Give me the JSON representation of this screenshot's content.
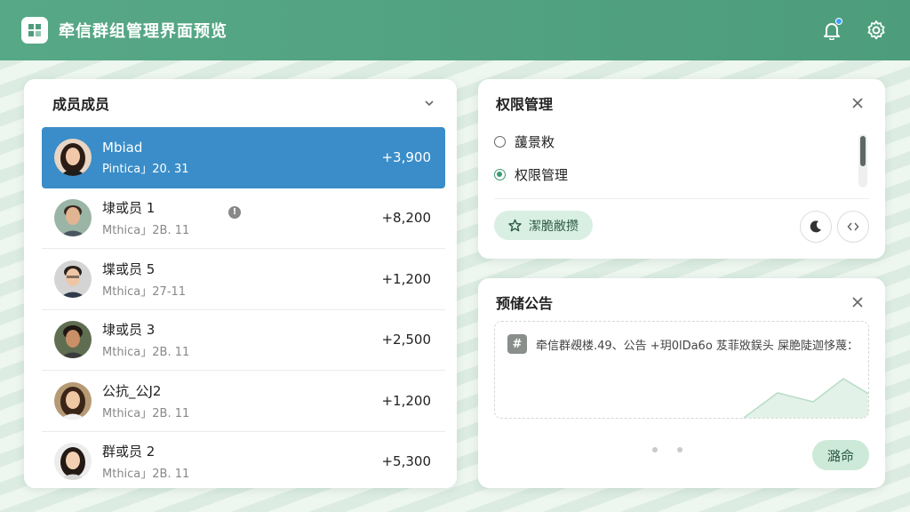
{
  "header": {
    "title": "牵信群组管理界面预览",
    "logo_icon": "grid-logo-icon",
    "actions": [
      {
        "icon": "bell-icon",
        "has_badge": true
      },
      {
        "icon": "gear-icon"
      }
    ]
  },
  "members": {
    "title": "成员成员",
    "items": [
      {
        "name": "Mbiad",
        "sub": "Pintica」20. 31",
        "value": "+3,900",
        "selected": true
      },
      {
        "name": "埭或员 1",
        "sub": "Mthica」2B. 11",
        "value": "+8,200",
        "info": "!"
      },
      {
        "name": "堞或员 5",
        "sub": "Mthica」27-11",
        "value": "+1,200"
      },
      {
        "name": "埭或员 3",
        "sub": "Mthica」2B. 11",
        "value": "+2,500"
      },
      {
        "name": "公抗_公J2",
        "sub": "Mthica」2B. 11",
        "value": "+1,200"
      },
      {
        "name": "群或员 2",
        "sub": "Mthica」2B. 11",
        "value": "+5,300"
      }
    ]
  },
  "permissions": {
    "title": "权限管理",
    "options": [
      {
        "label": "蘐景敉",
        "checked": false
      },
      {
        "label": "权限管理",
        "checked": true
      }
    ],
    "pill_label": "潔脆敝攒"
  },
  "notice": {
    "title": "预储公告",
    "icon_glyph": "#",
    "text": "牵信群覕楼.49、公告 +玥0lDa6o 芨菲敚鋘头 屎脃陡迦恀蔑：",
    "confirm_label": "潞命"
  },
  "colors": {
    "header": "#4d9d7c",
    "selected_row": "#3a8dc8",
    "accent": "#3d9970"
  }
}
